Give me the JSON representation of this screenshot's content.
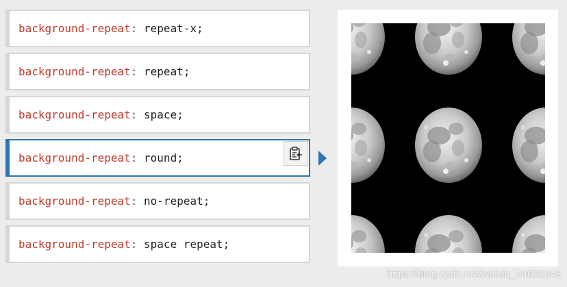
{
  "options": [
    {
      "property": "background-repeat",
      "value": "repeat-x;",
      "active": false
    },
    {
      "property": "background-repeat",
      "value": "repeat;",
      "active": false
    },
    {
      "property": "background-repeat",
      "value": "space;",
      "active": false
    },
    {
      "property": "background-repeat",
      "value": "round;",
      "active": true
    },
    {
      "property": "background-repeat",
      "value": "no-repeat;",
      "active": false
    },
    {
      "property": "background-repeat",
      "value": "space repeat;",
      "active": false
    }
  ],
  "copy_icon": "clipboard-copy-icon",
  "preview_image": "moon-tiled-round",
  "watermark": "https://blog.csdn.net/weixin_44601948",
  "colors": {
    "accent": "#2e74b8",
    "property": "#c0392b",
    "border": "#d6d6d6",
    "page_background": "#ececec"
  }
}
